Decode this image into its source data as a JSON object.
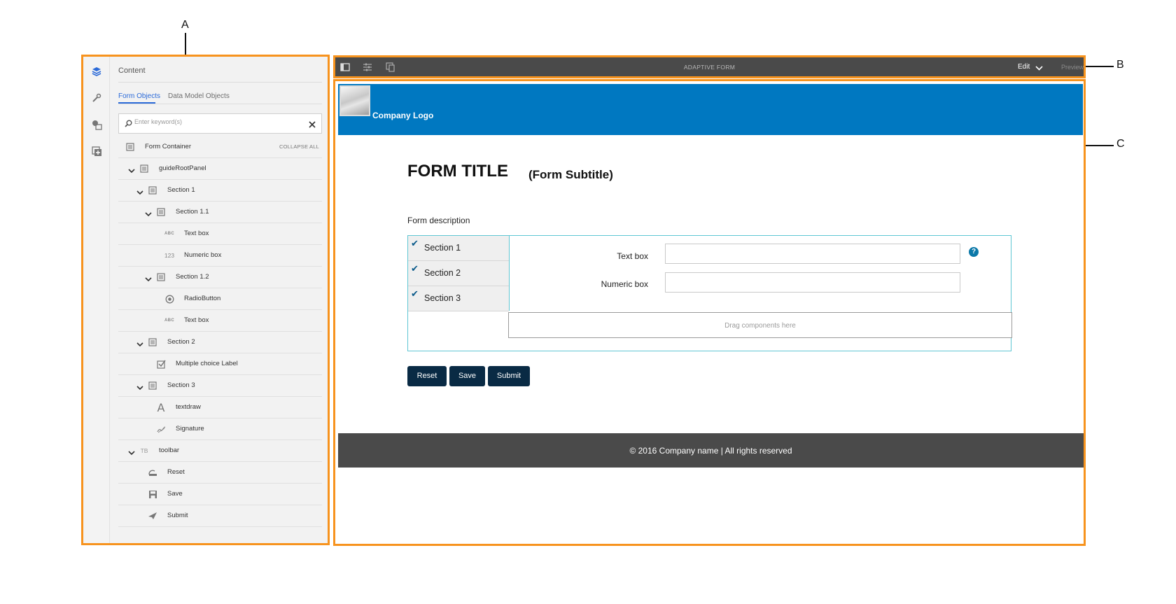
{
  "callouts": {
    "a": "A",
    "b": "B",
    "c": "C"
  },
  "left_panel": {
    "rail_icons": [
      "layers-icon",
      "wrench-icon",
      "assets-icon",
      "add-component-icon"
    ],
    "title": "Content",
    "tabs": [
      {
        "label": "Form Objects",
        "active": true
      },
      {
        "label": "Data Model Objects",
        "active": false
      }
    ],
    "search_placeholder": "Enter keyword(s)",
    "collapse_all": "COLLAPSE ALL",
    "tree": [
      {
        "label": "Form Container",
        "icon": "panel-icon"
      },
      {
        "label": "guideRootPanel",
        "icon": "panel-icon",
        "expanded": true
      },
      {
        "label": "Section 1",
        "icon": "panel-icon",
        "expanded": true
      },
      {
        "label": "Section 1.1",
        "icon": "panel-icon",
        "expanded": true
      },
      {
        "label": "Text box",
        "icon": "text-box-icon",
        "icon_text": "ABC"
      },
      {
        "label": "Numeric box",
        "icon": "numeric-box-icon",
        "icon_text": "123"
      },
      {
        "label": "Section 1.2",
        "icon": "panel-icon",
        "expanded": true
      },
      {
        "label": "RadioButton",
        "icon": "radio-button-icon"
      },
      {
        "label": "Text box",
        "icon": "text-box-icon",
        "icon_text": "ABC"
      },
      {
        "label": "Section 2",
        "icon": "panel-icon",
        "expanded": true
      },
      {
        "label": "Multiple choice Label",
        "icon": "checkbox-icon"
      },
      {
        "label": "Section 3",
        "icon": "panel-icon",
        "expanded": true
      },
      {
        "label": "textdraw",
        "icon": "text-draw-icon",
        "icon_text": "A"
      },
      {
        "label": "Signature",
        "icon": "signature-icon"
      },
      {
        "label": "toolbar",
        "icon": "toolbar-icon",
        "icon_text": "TB",
        "expanded": true
      },
      {
        "label": "Reset",
        "icon": "reset-icon"
      },
      {
        "label": "Save",
        "icon": "save-icon"
      },
      {
        "label": "Submit",
        "icon": "submit-icon"
      }
    ]
  },
  "toolbar": {
    "icons": [
      "toggle-side-panel-icon",
      "properties-icon",
      "emulator-icon"
    ],
    "title": "ADAPTIVE FORM",
    "mode_label": "Edit",
    "preview_label": "Preview"
  },
  "form": {
    "logo_text": "Company Logo",
    "title": "FORM TITLE",
    "subtitle": "(Form Subtitle)",
    "description": "Form description",
    "sections": [
      "Section 1",
      "Section 2",
      "Section 3"
    ],
    "fields": [
      {
        "label": "Text box",
        "value": ""
      },
      {
        "label": "Numeric box",
        "value": ""
      }
    ],
    "help_glyph": "?",
    "drop_zone": "Drag components here",
    "buttons": {
      "reset": "Reset",
      "save": "Save",
      "submit": "Submit"
    },
    "footer": "© 2016 Company name | All rights reserved"
  },
  "colors": {
    "highlight_border": "#f7931e",
    "header_band": "#0078c1",
    "button_bg": "#092a44",
    "footer_band": "#4a4a4a",
    "panel_border": "#5fc6d3",
    "active_tab": "#2b6ad8"
  }
}
